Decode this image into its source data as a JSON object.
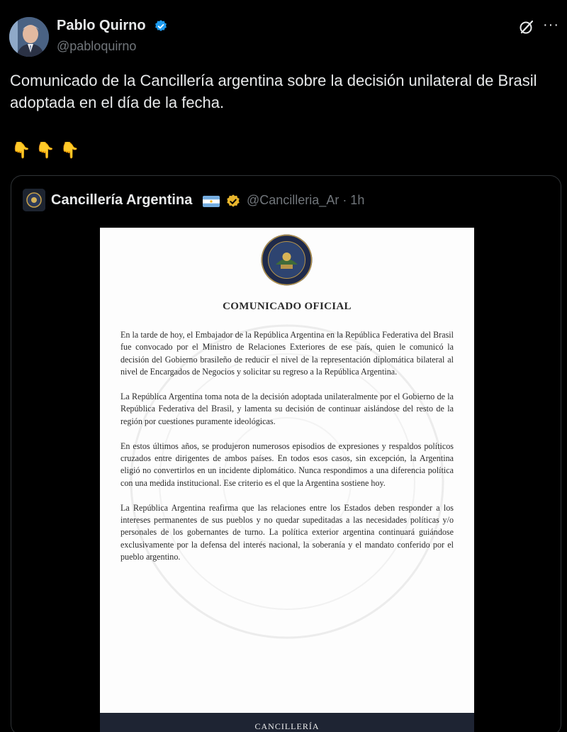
{
  "author": {
    "name": "Pablo Quirno",
    "handle": "@pabloquirno",
    "verified_color": "#1d9bf0"
  },
  "actions": {
    "grok_icon": "grok-icon",
    "more_icon": "more-icon"
  },
  "tweet": {
    "text": "Comunicado de la Cancillería argentina sobre la decisión unilateral de Brasil adoptada en el día de la fecha.",
    "emojis": [
      "👇",
      "👇",
      "👇"
    ]
  },
  "quote": {
    "name": "Cancillería Argentina",
    "handle_time": "@Cancilleria_Ar · 1h",
    "verified_color": "#e8b52c",
    "document": {
      "title": "COMUNICADO OFICIAL",
      "paragraphs": [
        "En la tarde de hoy, el Embajador de la República Argentina en la República Federativa del Brasil fue convocado por el Ministro de Relaciones Exteriores de ese país, quien le comunicó la decisión del Gobierno brasileño de reducir el nivel de la representación diplomática bilateral al nivel de Encargados de Negocios y solicitar su regreso a la República Argentina.",
        "La República Argentina toma nota de la decisión adoptada unilateralmente por el Gobierno de la República Federativa del Brasil, y lamenta su decisión de continuar aislándose del resto de la región por cuestiones puramente ideológicas.",
        "En estos últimos años, se produjeron numerosos episodios de expresiones y respaldos políticos cruzados entre dirigentes de ambos países. En todos esos casos, sin excepción, la Argentina eligió no convertirlos en un incidente diplomático. Nunca respondimos a una diferencia política con una medida institucional. Ese criterio es el que la Argentina sostiene hoy.",
        "La República Argentina reafirma que las relaciones entre los Estados deben responder a los intereses permanentes de sus pueblos y no quedar supeditadas a las necesidades políticas y/o personales de los gobernantes de turno. La política exterior argentina continuará guiándose exclusivamente por la defensa del interés nacional, la soberanía y el mandato conferido por el pueblo argentino."
      ],
      "footer": "CANCILLERÍA"
    }
  }
}
